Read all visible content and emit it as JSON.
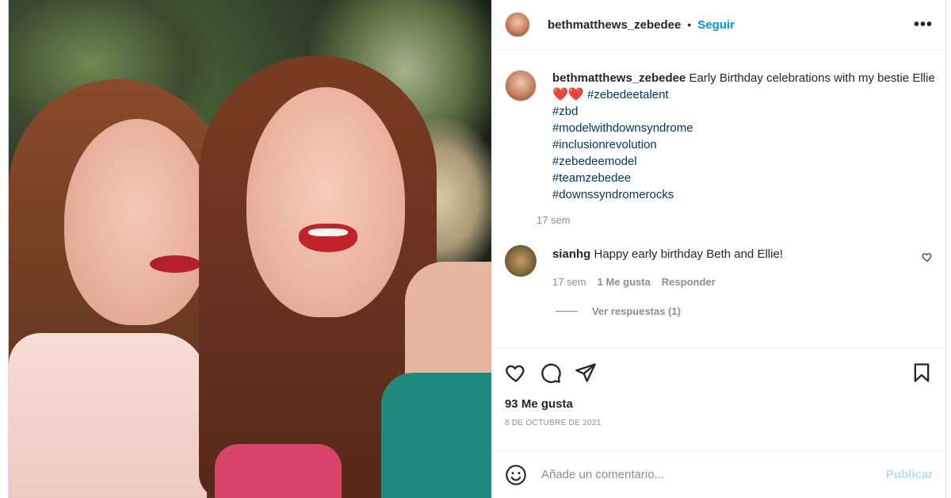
{
  "post": {
    "username": "bethmatthews_zebedee",
    "separator": "•",
    "follow_label": "Seguir",
    "more_label": "•••"
  },
  "caption": {
    "username": "bethmatthews_zebedee",
    "text": "Early Birthday celebrations with my bestie Ellie",
    "hearts": "❤️❤️",
    "inline_tag": "#zebedeetalent",
    "hashtags": [
      "#zbd",
      "#modelwithdownsyndrome",
      "#inclusionrevolution",
      "#zebedeemodel",
      "#teamzebedee",
      "#downssyndromerocks"
    ],
    "time": "17 sem"
  },
  "comment": {
    "username": "sianhg",
    "text": "Happy early birthday Beth and Ellie!",
    "time": "17 sem",
    "likes": "1 Me gusta",
    "reply_label": "Responder",
    "view_replies": "Ver respuestas (1)"
  },
  "actions": {
    "like_icon": "heart-outline-icon",
    "comment_icon": "comment-bubble-icon",
    "share_icon": "paper-plane-icon",
    "save_icon": "bookmark-icon"
  },
  "likes_text": "93 Me gusta",
  "date_text": "8 DE OCTUBRE DE 2021",
  "composer": {
    "placeholder": "Añade un comentario...",
    "publish_label": "Publicar"
  },
  "colors": {
    "link_blue": "#0095f6",
    "hashtag": "#00376b",
    "muted": "#8e8e8e",
    "publish_disabled": "#b2dffc"
  }
}
